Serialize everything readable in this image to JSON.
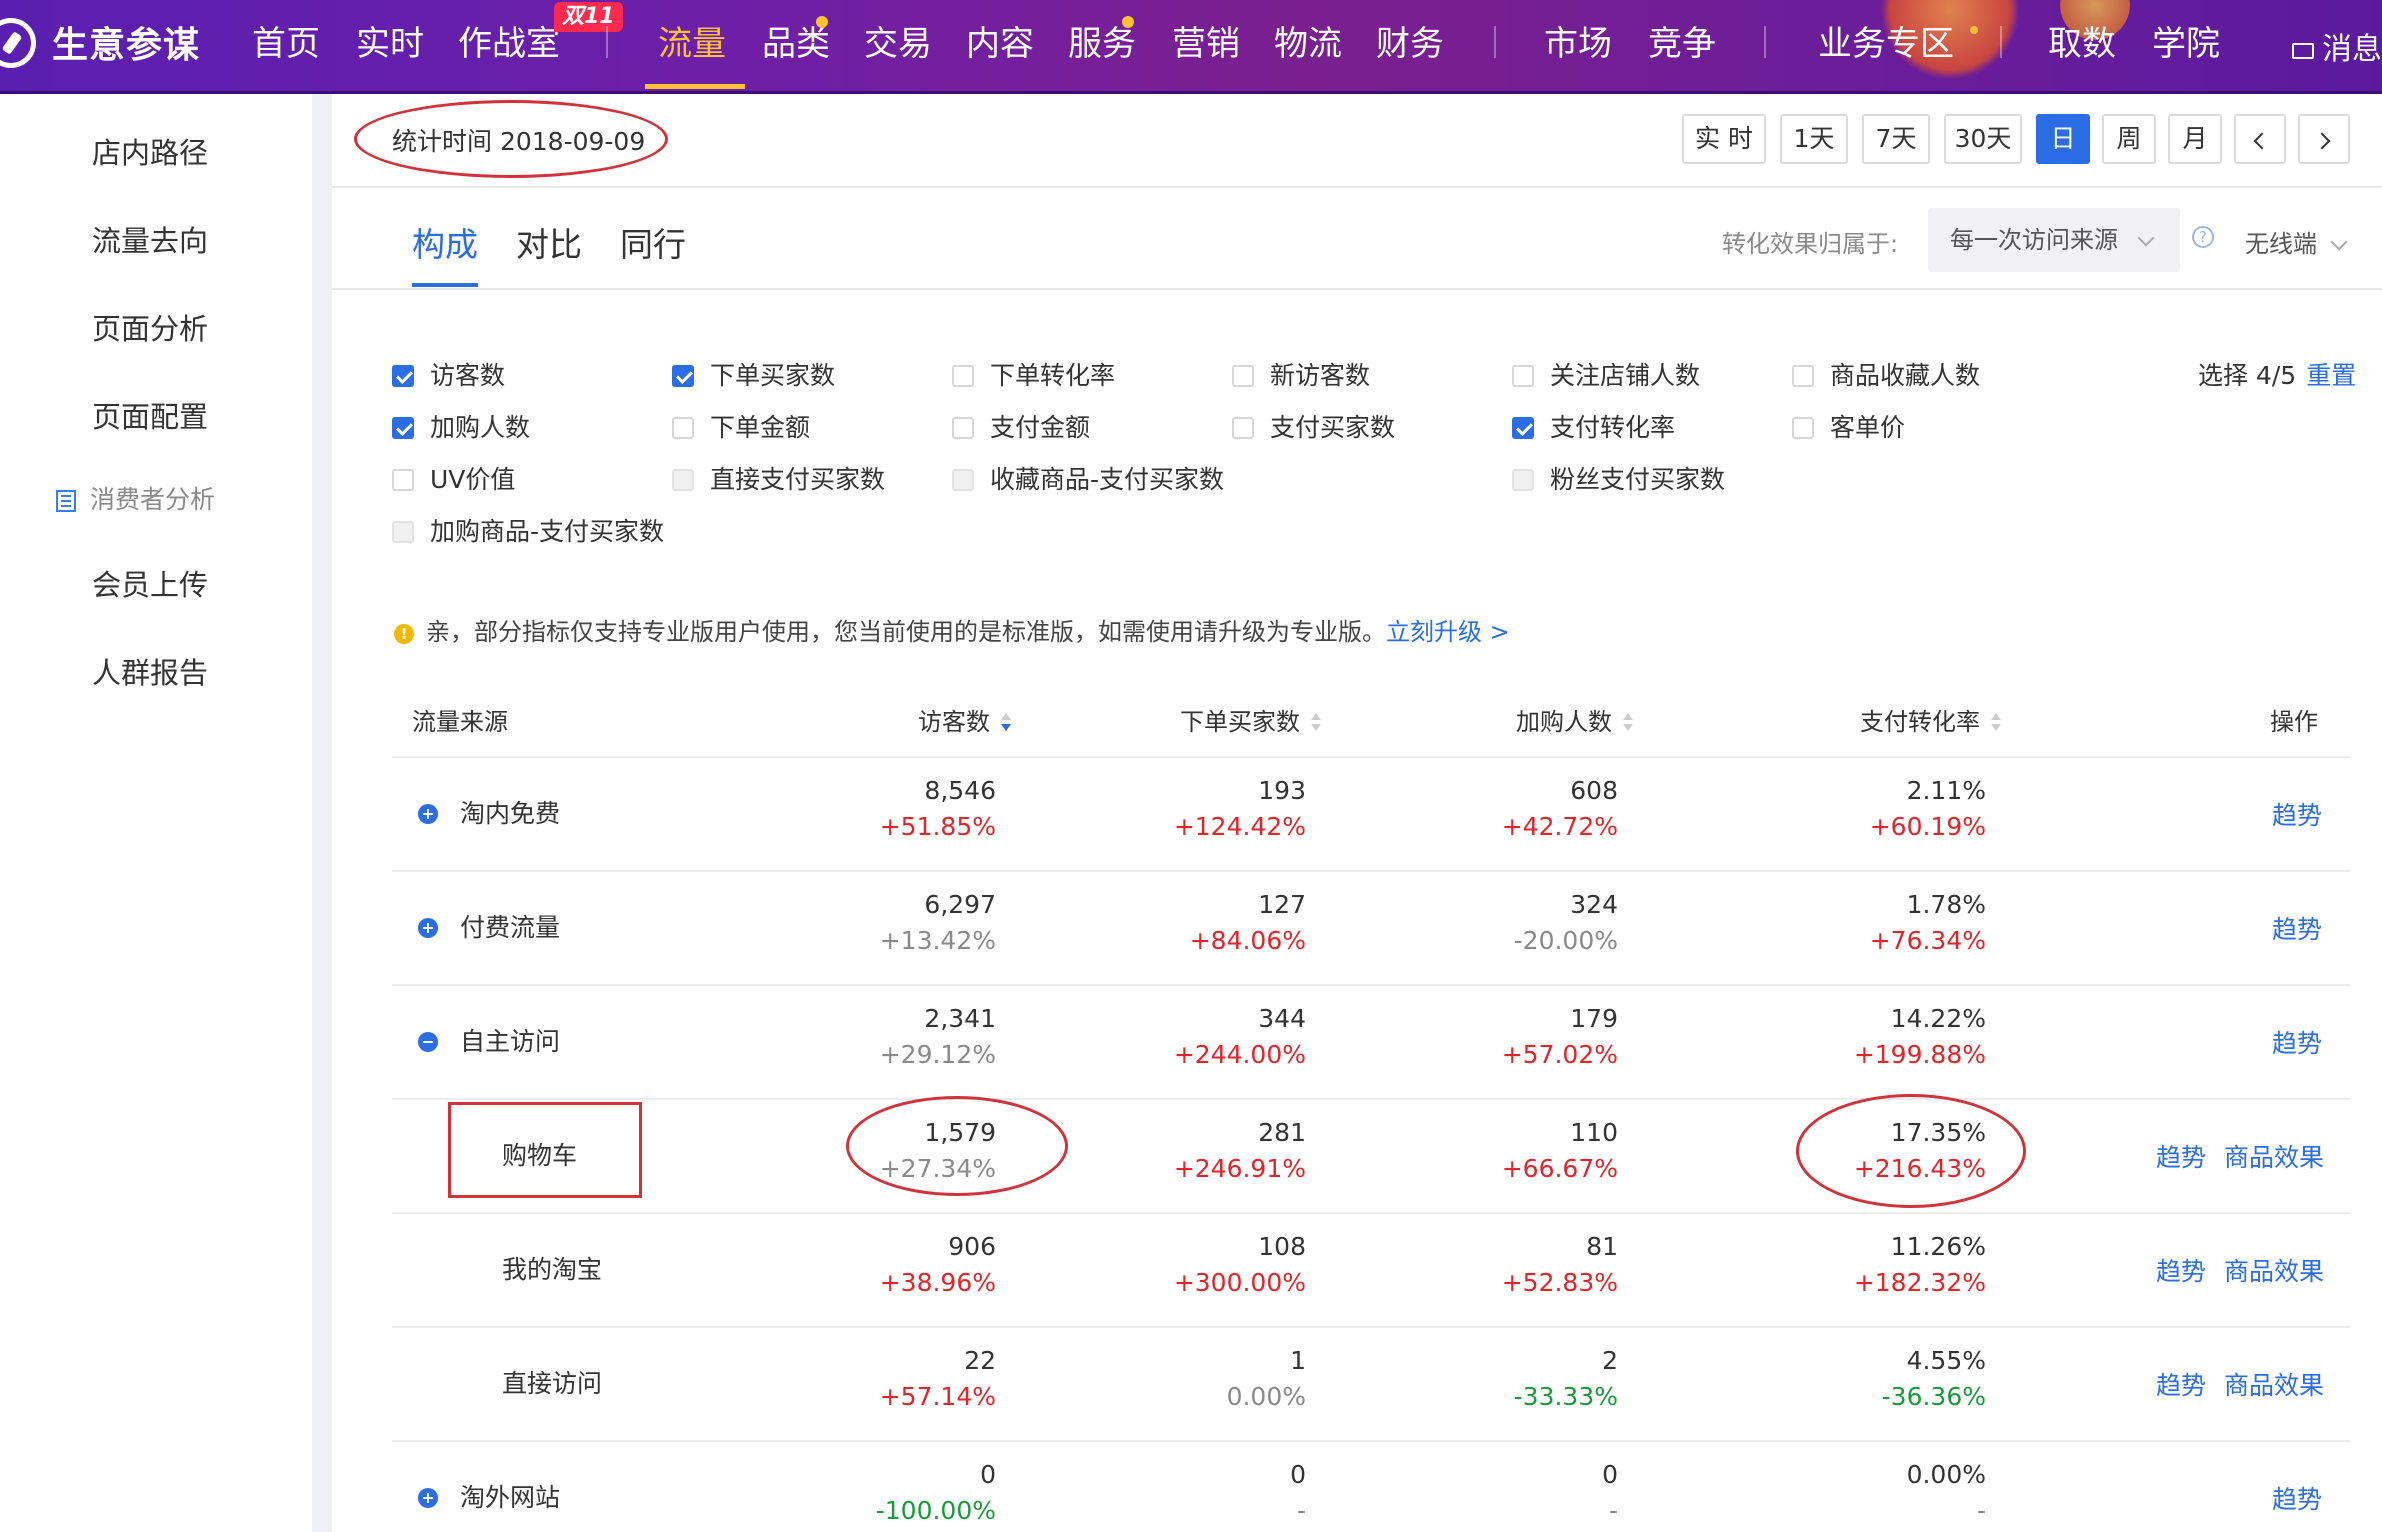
{
  "brand": "生意参谋",
  "nav": {
    "items": [
      "首页",
      "实时",
      "作战室",
      "流量",
      "品类",
      "交易",
      "内容",
      "服务",
      "营销",
      "物流",
      "财务",
      "市场",
      "竞争",
      "业务专区",
      "取数",
      "学院"
    ],
    "badge": "双11",
    "active": "流量",
    "messages": "消息"
  },
  "sidebar": {
    "items": [
      "店内路径",
      "流量去向",
      "页面分析",
      "页面配置"
    ],
    "group": "消费者分析",
    "group_items": [
      "会员上传",
      "人群报告"
    ]
  },
  "header": {
    "stat_time": "统计时间 2018-09-09",
    "range_buttons": [
      "实 时",
      "1天",
      "7天",
      "30天",
      "日",
      "周",
      "月"
    ],
    "active_range": "日"
  },
  "tabs": {
    "items": [
      "构成",
      "对比",
      "同行"
    ],
    "active": "构成",
    "attribution_label": "转化效果归属于:",
    "attribution_value": "每一次访问来源",
    "device": "无线端"
  },
  "metrics": {
    "options": [
      {
        "label": "访客数",
        "state": "checked"
      },
      {
        "label": "下单买家数",
        "state": "checked"
      },
      {
        "label": "下单转化率",
        "state": "unchecked"
      },
      {
        "label": "新访客数",
        "state": "unchecked"
      },
      {
        "label": "关注店铺人数",
        "state": "unchecked"
      },
      {
        "label": "商品收藏人数",
        "state": "unchecked"
      },
      {
        "label": "加购人数",
        "state": "checked"
      },
      {
        "label": "下单金额",
        "state": "unchecked"
      },
      {
        "label": "支付金额",
        "state": "unchecked"
      },
      {
        "label": "支付买家数",
        "state": "unchecked"
      },
      {
        "label": "支付转化率",
        "state": "checked"
      },
      {
        "label": "客单价",
        "state": "unchecked"
      },
      {
        "label": "UV价值",
        "state": "unchecked"
      },
      {
        "label": "直接支付买家数",
        "state": "disabled"
      },
      {
        "label": "收藏商品-支付买家数",
        "state": "disabled"
      },
      {
        "label": "粉丝支付买家数",
        "state": "disabled"
      },
      {
        "label": "加购商品-支付买家数",
        "state": "disabled"
      }
    ],
    "selected_count": "选择 4/5",
    "reset": "重置"
  },
  "notice": {
    "text": "亲，部分指标仅支持专业版用户使用，您当前使用的是标准版，如需使用请升级为专业版。",
    "link": "立刻升级 >"
  },
  "table": {
    "headers": [
      "流量来源",
      "访客数",
      "下单买家数",
      "加购人数",
      "支付转化率",
      "操作"
    ],
    "rows": [
      {
        "source": "淘内免费",
        "expand": "plus",
        "cells": [
          [
            "8,546",
            "+51.85%",
            "up"
          ],
          [
            "193",
            "+124.42%",
            "up"
          ],
          [
            "608",
            "+42.72%",
            "up"
          ],
          [
            "2.11%",
            "+60.19%",
            "up"
          ]
        ],
        "actions": [
          "趋势"
        ]
      },
      {
        "source": "付费流量",
        "expand": "plus",
        "cells": [
          [
            "6,297",
            "+13.42%",
            "neutral"
          ],
          [
            "127",
            "+84.06%",
            "up"
          ],
          [
            "324",
            "-20.00%",
            "neutral"
          ],
          [
            "1.78%",
            "+76.34%",
            "up"
          ]
        ],
        "actions": [
          "趋势"
        ]
      },
      {
        "source": "自主访问",
        "expand": "minus",
        "cells": [
          [
            "2,341",
            "+29.12%",
            "neutral"
          ],
          [
            "344",
            "+244.00%",
            "up"
          ],
          [
            "179",
            "+57.02%",
            "up"
          ],
          [
            "14.22%",
            "+199.88%",
            "up"
          ]
        ],
        "actions": [
          "趋势"
        ]
      },
      {
        "source": "购物车",
        "expand": "child",
        "cells": [
          [
            "1,579",
            "+27.34%",
            "neutral"
          ],
          [
            "281",
            "+246.91%",
            "up"
          ],
          [
            "110",
            "+66.67%",
            "up"
          ],
          [
            "17.35%",
            "+216.43%",
            "up"
          ]
        ],
        "actions": [
          "趋势",
          "商品效果"
        ]
      },
      {
        "source": "我的淘宝",
        "expand": "child",
        "cells": [
          [
            "906",
            "+38.96%",
            "up"
          ],
          [
            "108",
            "+300.00%",
            "up"
          ],
          [
            "81",
            "+52.83%",
            "up"
          ],
          [
            "11.26%",
            "+182.32%",
            "up"
          ]
        ],
        "actions": [
          "趋势",
          "商品效果"
        ]
      },
      {
        "source": "直接访问",
        "expand": "child",
        "cells": [
          [
            "22",
            "+57.14%",
            "up"
          ],
          [
            "1",
            "0.00%",
            "neutral"
          ],
          [
            "2",
            "-33.33%",
            "down"
          ],
          [
            "4.55%",
            "-36.36%",
            "down"
          ]
        ],
        "actions": [
          "趋势",
          "商品效果"
        ]
      },
      {
        "source": "淘外网站",
        "expand": "plus",
        "cells": [
          [
            "0",
            "-100.00%",
            "down"
          ],
          [
            "0",
            "-",
            "neutral"
          ],
          [
            "0",
            "-",
            "neutral"
          ],
          [
            "0.00%",
            "-",
            "neutral"
          ]
        ],
        "actions": [
          "趋势"
        ]
      }
    ]
  }
}
